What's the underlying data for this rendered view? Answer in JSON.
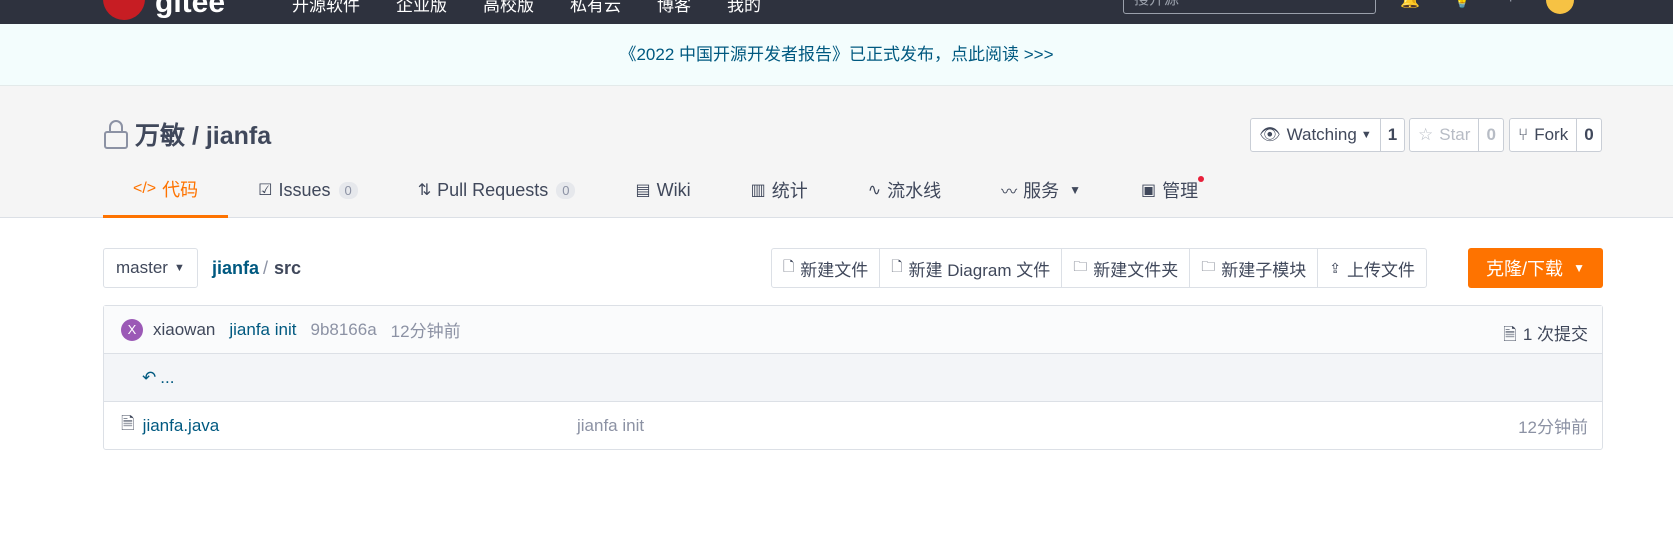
{
  "topnav": {
    "logo_text": "gitee",
    "links": [
      "开源软件",
      "企业版",
      "高校版",
      "私有云",
      "博客",
      "我的"
    ],
    "search_placeholder": "搜开源"
  },
  "banner": {
    "text": "《2022 中国开源开发者报告》已正式发布，点此阅读 >>>"
  },
  "project": {
    "title": "万敏 / jianfa",
    "watch_label": "Watching",
    "watch_count": "1",
    "star_label": "Star",
    "star_count": "0",
    "fork_label": "Fork",
    "fork_count": "0"
  },
  "tabs": [
    {
      "label": "代码",
      "icon": "code-icon"
    },
    {
      "label": "Issues",
      "count": "0",
      "icon": "issues-icon"
    },
    {
      "label": "Pull Requests",
      "count": "0",
      "icon": "pull-request-icon"
    },
    {
      "label": "Wiki",
      "icon": "wiki-icon"
    },
    {
      "label": "统计",
      "icon": "stats-icon"
    },
    {
      "label": "流水线",
      "icon": "pipeline-icon"
    },
    {
      "label": "服务",
      "icon": "service-icon"
    },
    {
      "label": "管理",
      "icon": "manage-icon"
    }
  ],
  "toolbar": {
    "branch": "master",
    "path_repo": "jianfa",
    "path_sep": "/",
    "path_current": "src",
    "buttons": [
      "新建文件",
      "新建 Diagram 文件",
      "新建文件夹",
      "新建子模块",
      "上传文件"
    ],
    "clone_label": "克隆/下载"
  },
  "commit": {
    "avatar_letter": "X",
    "author": "xiaowan",
    "message": "jianfa init",
    "hash": "9b8166a",
    "time": "12分钟前",
    "count_label": "1 次提交"
  },
  "up": {
    "label": "..."
  },
  "files": [
    {
      "name": "jianfa.java",
      "message": "jianfa init",
      "time": "12分钟前"
    }
  ],
  "colors": {
    "accent": "#fe7300",
    "link": "#005980",
    "nav_bg": "#2e323e"
  }
}
